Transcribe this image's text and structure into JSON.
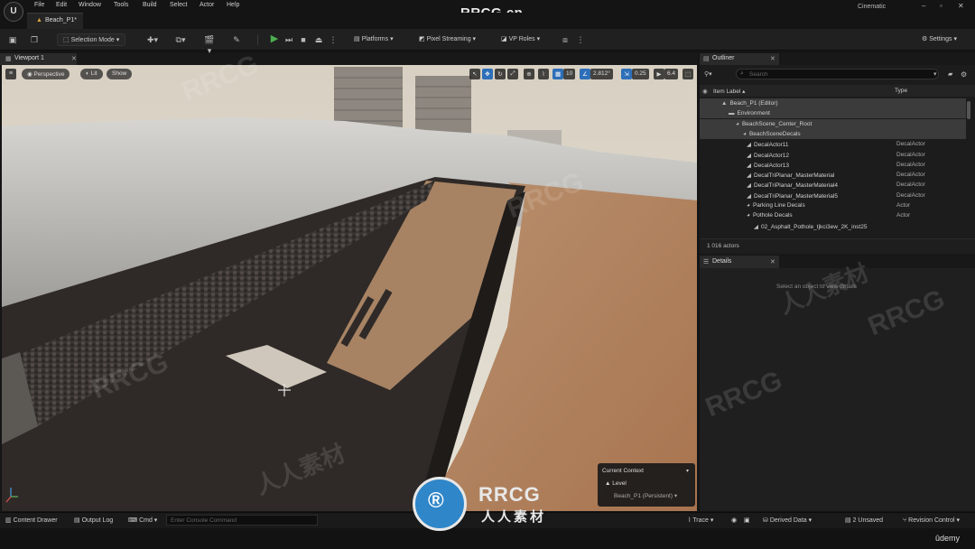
{
  "window": {
    "menu": [
      "File",
      "Edit",
      "Window",
      "Tools",
      "Build",
      "Select",
      "Actor",
      "Help"
    ],
    "document_tab": "Beach_P1*",
    "brand_overlay": "RRCG.cn",
    "layout_name": "Cinematic"
  },
  "toolbar": {
    "selection_mode": "Selection Mode",
    "platforms": "Platforms",
    "pixel_streaming": "Pixel Streaming",
    "vp_roles": "VP Roles",
    "settings": "Settings"
  },
  "viewport": {
    "tab": "Viewport 1",
    "perspective": "Perspective",
    "lit": "Lit",
    "show": "Show",
    "grid_snap": "10",
    "rotation_snap": "2.812°",
    "scale_snap": "0.25",
    "camera_speed": "6.4",
    "context": {
      "title": "Current Context",
      "level_label": "Level",
      "level_value": "Beach_P1 (Persistent)"
    }
  },
  "outliner": {
    "tab": "Outliner",
    "search_placeholder": "Search",
    "col_label": "Item Label",
    "col_type": "Type",
    "rows": [
      {
        "label": "Beach_P1 (Editor)",
        "type": "",
        "indent": 24,
        "icon": "level-icon",
        "selected": true
      },
      {
        "label": "Environment",
        "type": "",
        "indent": 32,
        "icon": "folder-icon",
        "selected": true
      },
      {
        "label": "BeachScene_Center_Root",
        "type": "",
        "indent": 40,
        "icon": "actor-icon",
        "selected": true
      },
      {
        "label": "BeachSceneDecals",
        "type": "",
        "indent": 48,
        "icon": "actor-icon",
        "selected": true
      },
      {
        "label": "DecalActor11",
        "type": "DecalActor",
        "indent": 52,
        "icon": "decal-icon",
        "selected": false
      },
      {
        "label": "DecalActor12",
        "type": "DecalActor",
        "indent": 52,
        "icon": "decal-icon",
        "selected": false
      },
      {
        "label": "DecalActor13",
        "type": "DecalActor",
        "indent": 52,
        "icon": "decal-icon",
        "selected": false
      },
      {
        "label": "DecalTriPlanar_MasterMaterial",
        "type": "DecalActor",
        "indent": 52,
        "icon": "decal-icon",
        "selected": false
      },
      {
        "label": "DecalTriPlanar_MasterMaterial4",
        "type": "DecalActor",
        "indent": 52,
        "icon": "decal-icon",
        "selected": false
      },
      {
        "label": "DecalTriPlanar_MasterMaterial5",
        "type": "DecalActor",
        "indent": 52,
        "icon": "decal-icon",
        "selected": false
      },
      {
        "label": "Parking Line Decals",
        "type": "Actor",
        "indent": 52,
        "icon": "actor-icon",
        "selected": false
      },
      {
        "label": "Pothole Decals",
        "type": "Actor",
        "indent": 52,
        "icon": "actor-icon",
        "selected": false
      },
      {
        "label": "02_Asphalt_Pothole_tjkci3ew_2K_inst25",
        "type": "",
        "indent": 60,
        "icon": "decal-icon",
        "selected": false
      }
    ],
    "actor_count": "1 016 actors"
  },
  "details": {
    "tab": "Details",
    "empty_text": "Select an object to view details"
  },
  "statusbar": {
    "content_drawer": "Content Drawer",
    "output_log": "Output Log",
    "cmd": "Cmd",
    "console_placeholder": "Enter Console Command",
    "trace": "Trace",
    "derived_data": "Derived Data",
    "unsaved": "2 Unsaved",
    "revision_control": "Revision Control"
  },
  "watermark": {
    "brand": "RRCG",
    "chinese": "人人素材",
    "udemy": "ûdemy"
  },
  "colors": {
    "accent_blue": "#2d6fb8",
    "play_green": "#4caf50",
    "panel_bg": "#1c1c1c"
  }
}
